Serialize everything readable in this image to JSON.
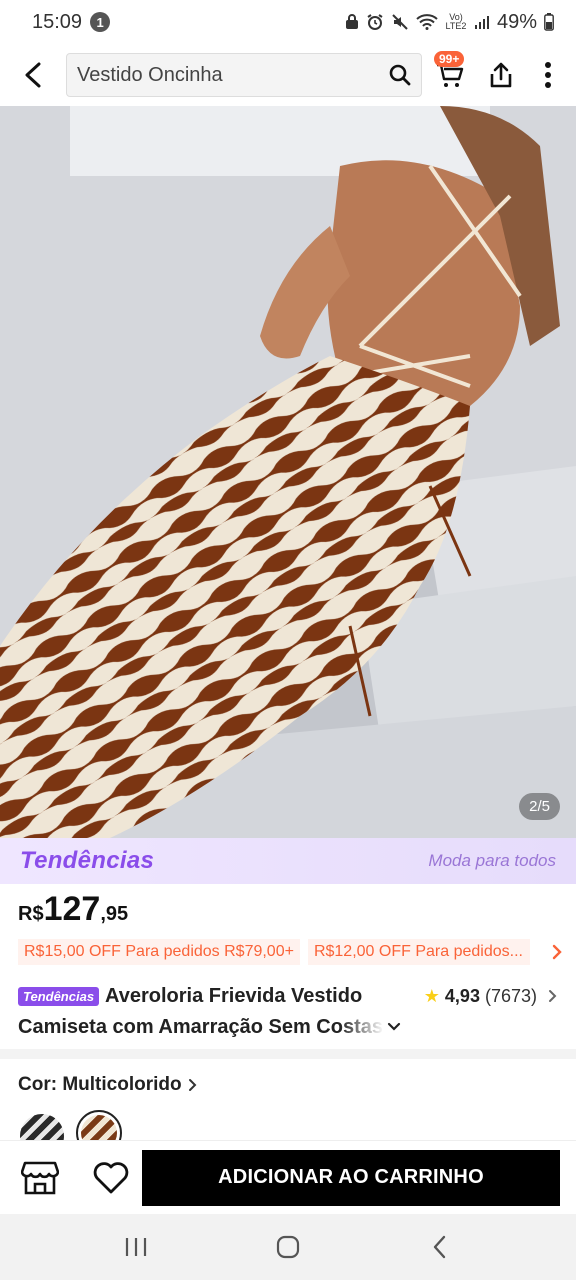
{
  "status_bar": {
    "time": "15:09",
    "notification_count": "1",
    "network_label": "Vo) LTE2",
    "battery": "49%"
  },
  "search": {
    "value": "Vestido Oncinha"
  },
  "cart": {
    "badge": "99+"
  },
  "product": {
    "image_counter": "2/5",
    "trend_logo": "Tendências",
    "trend_slogan": "Moda para todos",
    "price_currency": "R$",
    "price_int": "127",
    "price_dec": ",95",
    "coupons": [
      "R$15,00 OFF Para pedidos R$79,00+",
      "R$12,00 OFF Para pedidos..."
    ],
    "title_badge": "Tendências",
    "title_line1": "Averoloria Frievida Vestido",
    "title_line2": "Camiseta com Amarração Sem Costas",
    "rating_value": "4,93",
    "rating_count": "(7673)",
    "color_label": "Cor: Multicolorido"
  },
  "actions": {
    "add_to_cart": "ADICIONAR AO CARRINHO"
  },
  "colors": {
    "accent": "#fa6338",
    "trend_purple": "#8a4dea",
    "star": "#facf19"
  }
}
